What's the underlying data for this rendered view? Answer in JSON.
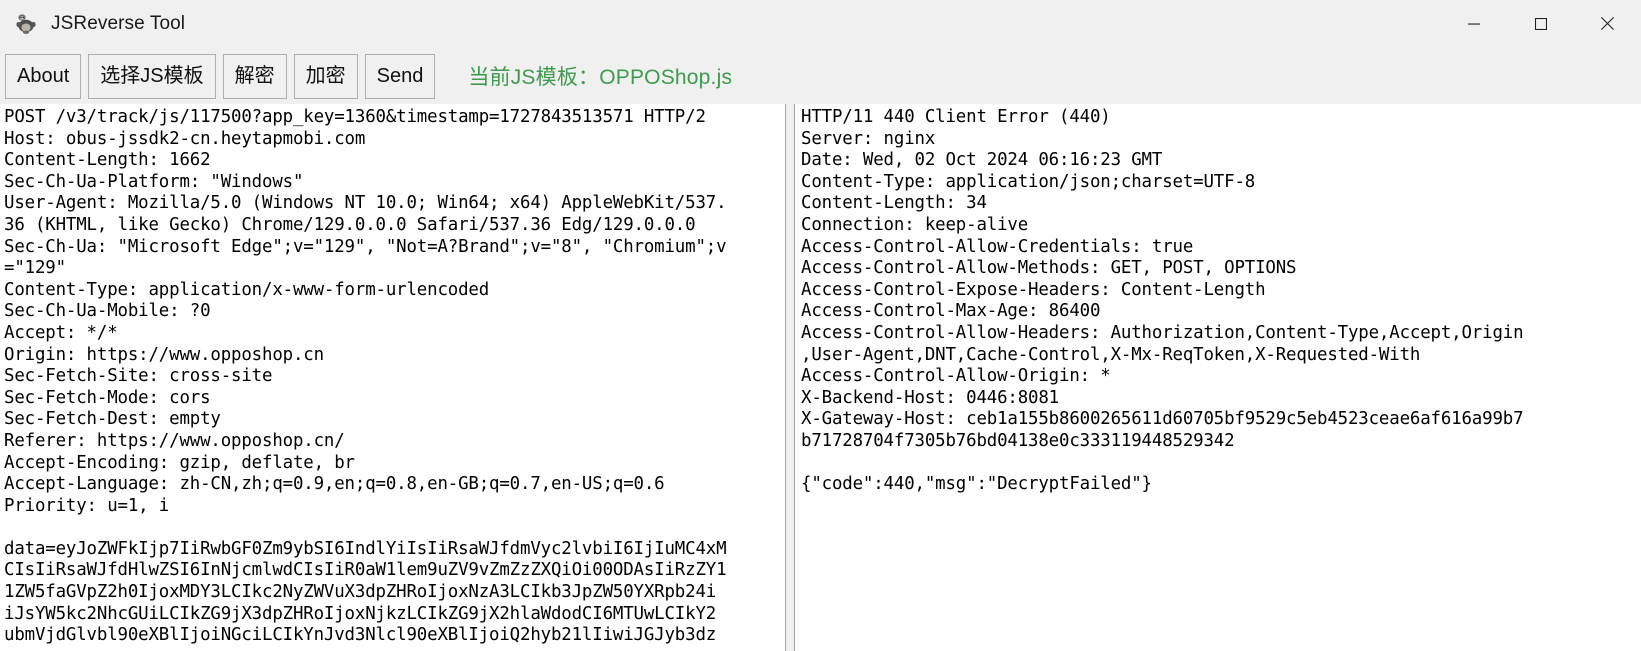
{
  "window": {
    "title": "JSReverse Tool",
    "icon": "app-monkey-icon",
    "buttons": {
      "minimize": "minimize-icon",
      "maximize": "maximize-icon",
      "close": "close-icon"
    }
  },
  "toolbar": {
    "about_label": "About",
    "select_template_label": "选择JS模板",
    "decrypt_label": "解密",
    "encrypt_label": "加密",
    "send_label": "Send",
    "template_note": "当前JS模板：OPPOShop.js",
    "template_note_color": "#3e9a4e"
  },
  "request_pane": {
    "name": "http-request-view",
    "content": "POST /v3/track/js/117500?app_key=1360&timestamp=1727843513571 HTTP/2\nHost: obus-jssdk2-cn.heytapmobi.com\nContent-Length: 1662\nSec-Ch-Ua-Platform: \"Windows\"\nUser-Agent: Mozilla/5.0 (Windows NT 10.0; Win64; x64) AppleWebKit/537.\n36 (KHTML, like Gecko) Chrome/129.0.0.0 Safari/537.36 Edg/129.0.0.0\nSec-Ch-Ua: \"Microsoft Edge\";v=\"129\", \"Not=A?Brand\";v=\"8\", \"Chromium\";v\n=\"129\"\nContent-Type: application/x-www-form-urlencoded\nSec-Ch-Ua-Mobile: ?0\nAccept: */*\nOrigin: https://www.opposhop.cn\nSec-Fetch-Site: cross-site\nSec-Fetch-Mode: cors\nSec-Fetch-Dest: empty\nReferer: https://www.opposhop.cn/\nAccept-Encoding: gzip, deflate, br\nAccept-Language: zh-CN,zh;q=0.9,en;q=0.8,en-GB;q=0.7,en-US;q=0.6\nPriority: u=1, i\n\ndata=eyJoZWFkIjp7IiRwbGF0Zm9ybSI6IndlYiIsIiRsaWJfdmVyc2lvbiI6IjIuMC4xM\nCIsIiRsaWJfdHlwZSI6InNjcmlwdCIsIiR0aW1lem9uZV9vZmZzZXQiOi00ODAsIiRzZY1\n1ZW5faGVpZ2h0IjoxMDY3LCIkc2NyZWVuX3dpZHRoIjoxNzA3LCIkb3JpZW50YXRpb24i\niJsYW5kc2NhcGUiLCIkZG9jX3dpZHRoIjoxNjkzLCIkZG9jX2hlaWdodCI6MTUwLCIkY2\nubmVjdGlvbl90eXBlIjoiNGciLCIkYnJvd3Nlcl90eXBlIjoiQ2hyb21lIiwiJGJyb3dz"
  },
  "response_pane": {
    "name": "http-response-view",
    "content": "HTTP/11 440 Client Error (440)\nServer: nginx\nDate: Wed, 02 Oct 2024 06:16:23 GMT\nContent-Type: application/json;charset=UTF-8\nContent-Length: 34\nConnection: keep-alive\nAccess-Control-Allow-Credentials: true\nAccess-Control-Allow-Methods: GET, POST, OPTIONS\nAccess-Control-Expose-Headers: Content-Length\nAccess-Control-Max-Age: 86400\nAccess-Control-Allow-Headers: Authorization,Content-Type,Accept,Origin\n,User-Agent,DNT,Cache-Control,X-Mx-ReqToken,X-Requested-With\nAccess-Control-Allow-Origin: *\nX-Backend-Host: 0446:8081\nX-Gateway-Host: ceb1a155b8600265611d60705bf9529c5eb4523ceae6af616a99b7\nb71728704f7305b76bd04138e0c333119448529342\n\n{\"code\":440,\"msg\":\"DecryptFailed\"}"
  }
}
